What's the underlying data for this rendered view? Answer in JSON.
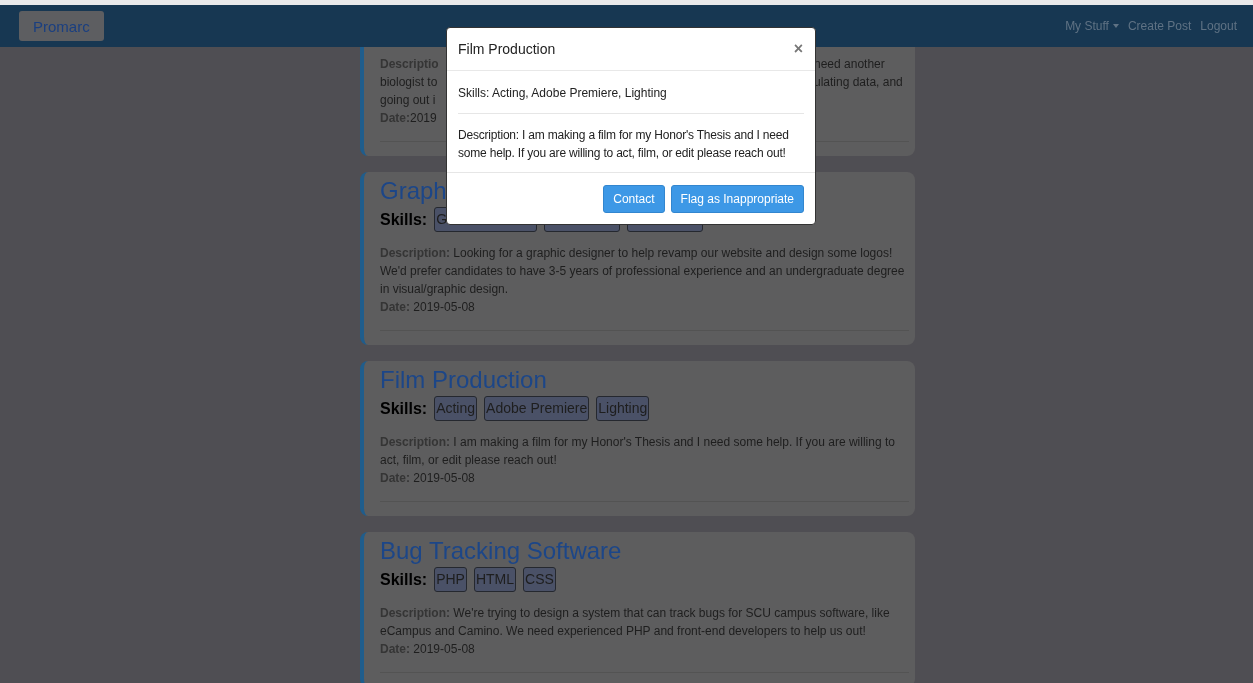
{
  "navbar": {
    "brand": "Promarc",
    "links": [
      {
        "label": "My Stuff",
        "dropdown": true
      },
      {
        "label": "Create Post",
        "dropdown": false
      },
      {
        "label": "Logout",
        "dropdown": false
      }
    ]
  },
  "partial_card": {
    "lines": [
      {
        "kind": "label",
        "left": "Descriptio",
        "right": "need another"
      },
      {
        "kind": "text",
        "left": "biologist to",
        "right": "ulating data, and"
      },
      {
        "kind": "text",
        "left": "going out i"
      }
    ],
    "date_label": "Date:",
    "date_value": "2019"
  },
  "posts": [
    {
      "title": "Graph",
      "skills_label": "Skills:",
      "tags": [
        {
          "kind": "partial",
          "label": "G"
        },
        {
          "kind": "covered"
        },
        {
          "kind": "covered"
        }
      ],
      "description_label": "Description:",
      "description": "Looking for a graphic designer to help revamp our website and design some logos! We'd prefer candidates to have 3-5 years of professional experience and an undergraduate degree in visual/graphic design.",
      "date_label": "Date:",
      "date": "2019-05-08"
    },
    {
      "title": "Film Production",
      "skills_label": "Skills:",
      "tags": [
        {
          "kind": "full",
          "label": "Acting"
        },
        {
          "kind": "full",
          "label": "Adobe Premiere"
        },
        {
          "kind": "full",
          "label": "Lighting"
        }
      ],
      "description_label": "Description:",
      "description": "I am making a film for my Honor's Thesis and I need some help. If you are willing to act, film, or edit please reach out!",
      "date_label": "Date:",
      "date": "2019-05-08"
    },
    {
      "title": "Bug Tracking Software",
      "skills_label": "Skills:",
      "tags": [
        {
          "kind": "full",
          "label": "PHP"
        },
        {
          "kind": "full",
          "label": "HTML"
        },
        {
          "kind": "full",
          "label": "CSS"
        }
      ],
      "description_label": "Description:",
      "description": "We're trying to design a system that can track bugs for SCU campus software, like eCampus and Camino. We need experienced PHP and front-end developers to help us out!",
      "date_label": "Date:",
      "date": "2019-05-08"
    }
  ],
  "modal": {
    "title": "Film Production",
    "close": "×",
    "skills": "Skills: Acting, Adobe Premiere, Lighting",
    "description": "Description: I am making a film for my Honor's Thesis and I need some help. If you are willing to act, film, or edit please reach out!",
    "buttons": [
      "Contact",
      "Flag as Inappropriate"
    ]
  }
}
